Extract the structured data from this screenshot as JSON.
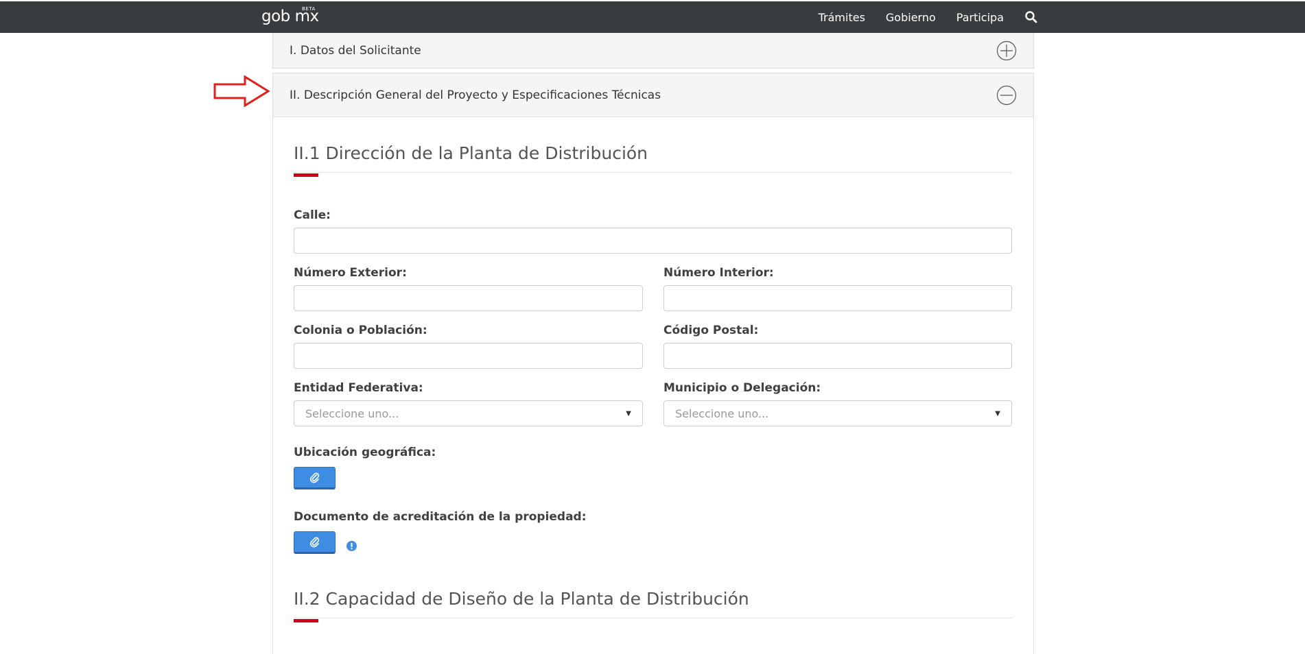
{
  "header": {
    "logo_main": "gob mx",
    "logo_beta": "BETA",
    "nav": [
      "Trámites",
      "Gobierno",
      "Participa"
    ],
    "search_icon": "search-icon"
  },
  "panels": {
    "datos": {
      "title": "I. Datos del Solicitante",
      "icon": "plus-circle-icon"
    },
    "descripcion": {
      "title": "II. Descripción General del Proyecto y Especificaciones Técnicas",
      "icon": "minus-circle-icon"
    }
  },
  "section1": {
    "title": "II.1 Dirección de la Planta de Distribución",
    "calle": {
      "label": "Calle:",
      "value": ""
    },
    "numero_exterior": {
      "label": "Número Exterior:",
      "value": ""
    },
    "numero_interior": {
      "label": "Número Interior:",
      "value": ""
    },
    "colonia": {
      "label": "Colonia o Población:",
      "value": ""
    },
    "codigo_postal": {
      "label": "Código Postal:",
      "value": ""
    },
    "entidad": {
      "label": "Entidad Federativa:",
      "selected": "Seleccione uno..."
    },
    "municipio": {
      "label": "Municipio o Delegación:",
      "selected": "Seleccione uno..."
    },
    "ubicacion": {
      "label": "Ubicación geográfica:",
      "icon": "paperclip-icon"
    },
    "documento": {
      "label": "Documento de acreditación de la propiedad:",
      "icon": "paperclip-icon",
      "info_icon": "exclamation-circle-icon"
    }
  },
  "section2": {
    "title": "II.2 Capacidad de Diseño de la Planta de Distribución"
  },
  "colors": {
    "topbar": "#393c3e",
    "accent_red": "#d0021b",
    "button_blue": "#3e8de2",
    "annotation_arrow": "#e0201e"
  }
}
